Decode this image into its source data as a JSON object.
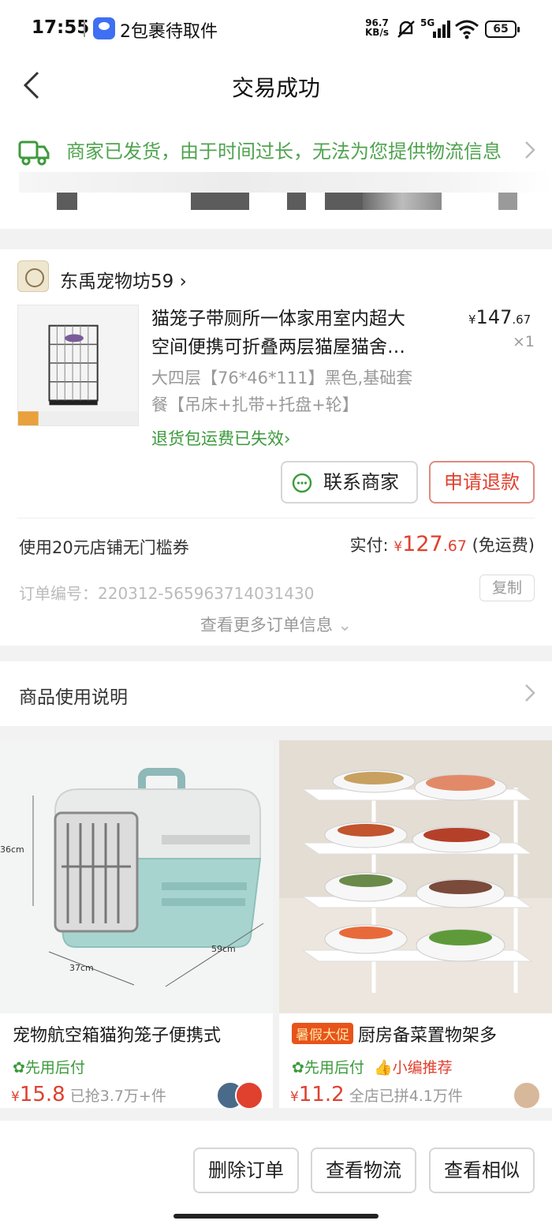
{
  "status_bar": {
    "time": "17:55",
    "notification": "2包裹待取件",
    "net_speed_value": "96.7",
    "net_speed_unit": "KB/s",
    "network": "5G",
    "battery": "65"
  },
  "nav": {
    "title": "交易成功"
  },
  "logistics": {
    "text": "商家已发货，由于时间过长，无法为您提供物流信息"
  },
  "order": {
    "shop_name": "东禹宠物坊59",
    "product_title_line1": "猫笼子带厕所一体家用室内超大",
    "product_title_line2": "空间便携可折叠两层猫屋猫舍…",
    "price_symbol": "¥",
    "price_int": "147",
    "price_dec": ".67",
    "quantity": "×1",
    "sku_line1": "大四层【76*46*111】黑色,基础套",
    "sku_line2": "餐【吊床+扎带+托盘+轮】",
    "return_note": "退货包运费已失效",
    "contact_button": "联系商家",
    "refund_button": "申请退款",
    "coupon_note": "使用20元店铺无门槛券",
    "paid_label": "实付:",
    "paid_symbol": "¥",
    "paid_int": "127",
    "paid_dec": ".67",
    "shipping_note": "(免运费)",
    "order_number": "订单编号：220312-565963714031430",
    "copy_button": "复制",
    "more_info": "查看更多订单信息"
  },
  "usage": {
    "label": "商品使用说明"
  },
  "recommendations": [
    {
      "title": "宠物航空箱猫狗笼子便携式",
      "badge": "先用后付",
      "price_symbol": "¥",
      "price": "15.8",
      "sold": "已抢3.7万+件",
      "img_dims": {
        "height": "36cm",
        "width": "37cm",
        "depth": "59cm"
      }
    },
    {
      "tag": "暑假大促",
      "title": "厨房备菜置物架多",
      "badge": "先用后付",
      "badge2": "小编推荐",
      "price_symbol": "¥",
      "price": "11.2",
      "sold": "全店已拼4.1万件"
    }
  ],
  "bottom_actions": {
    "delete": "删除订单",
    "logistics": "查看物流",
    "similar": "查看相似"
  },
  "colors": {
    "accent_red": "#e0402e",
    "accent_green": "#3c9a3c",
    "tag_orange": "#e8531a"
  }
}
